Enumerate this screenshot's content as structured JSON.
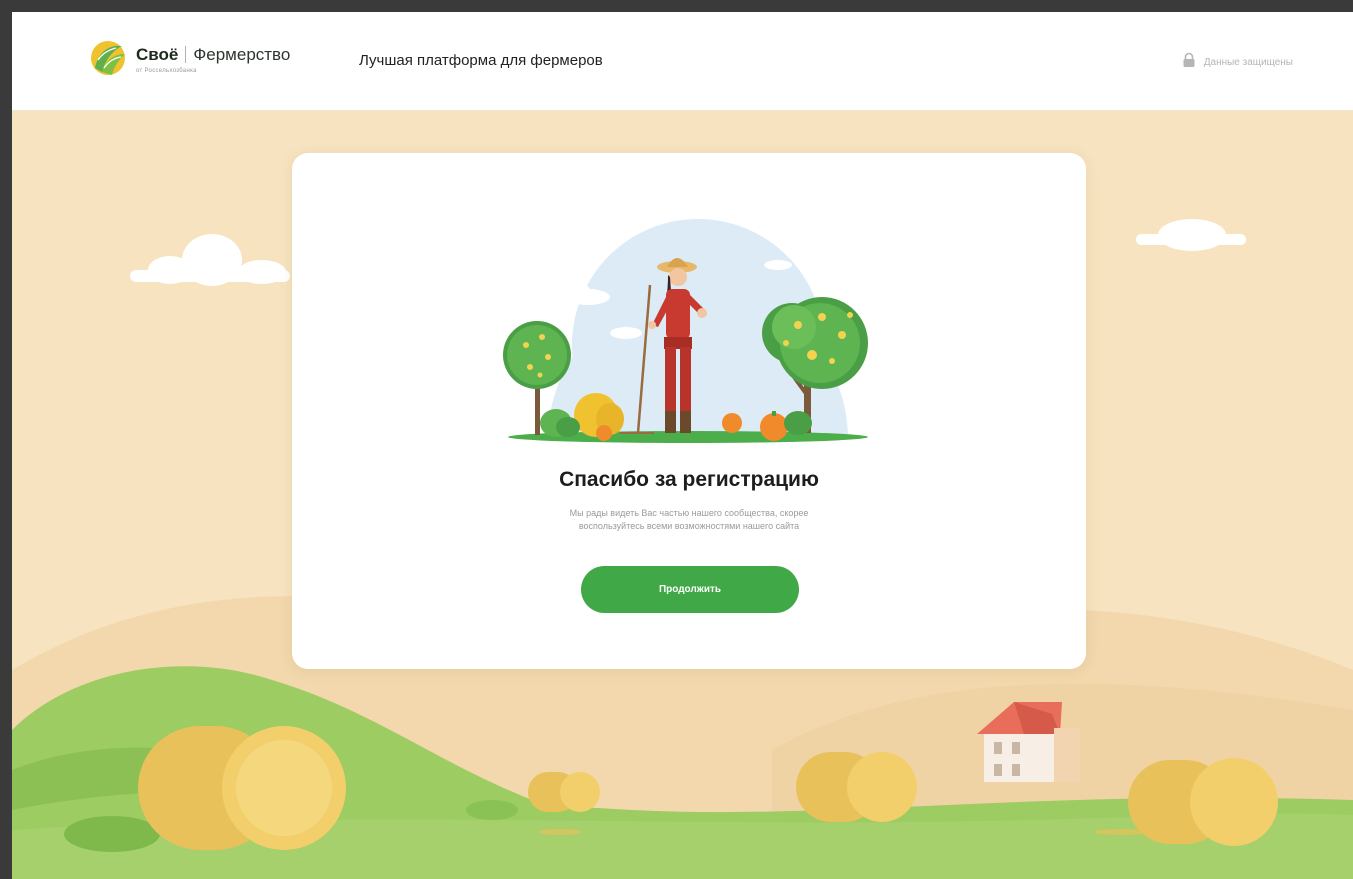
{
  "header": {
    "brand_name": "Своё",
    "brand_product": "Фермерство",
    "brand_sub": "от Россельхозбанка",
    "tagline": "Лучшая платформа для фермеров",
    "secure_label": "Данные защищены",
    "secure_icon": "lock-icon"
  },
  "card": {
    "title": "Спасибо за регистрацию",
    "text_line1": "Мы рады видеть Вас частью нашего сообщества, скорее",
    "text_line2": "воспользуйтесь всеми возможностями нашего сайта",
    "button_label": "Продолжить"
  },
  "colors": {
    "accent_green": "#41a847",
    "background_sand": "#f7e3bf",
    "hill_green": "#8fc75a",
    "hay_yellow": "#f2cf6a"
  }
}
